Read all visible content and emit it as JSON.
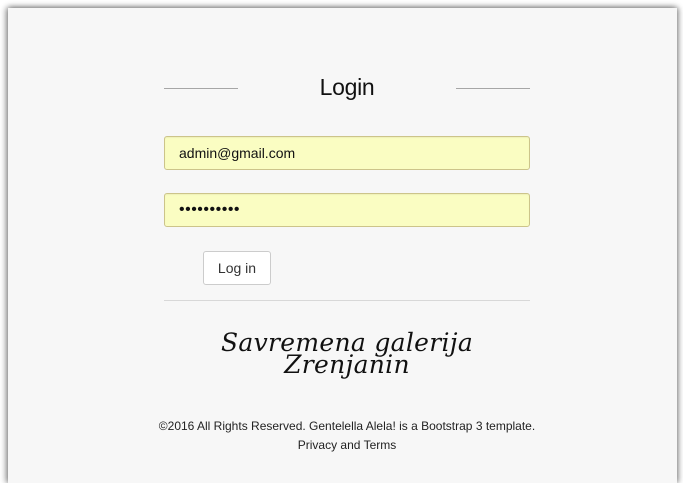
{
  "login": {
    "title": "Login",
    "email_value": "admin@gmail.com",
    "password_value": "••••••••••",
    "button_label": "Log in"
  },
  "brand": {
    "line1": "Savremena galerija",
    "line2": "Zrenjanin"
  },
  "footer": {
    "text": "©2016 All Rights Reserved. Gentelella Alela! is a Bootstrap 3 template.",
    "privacy_link": "Privacy and Terms"
  },
  "colors": {
    "background": "#f7f7f7",
    "input_autofill": "#fafdc2",
    "button_border": "#cccccc"
  }
}
